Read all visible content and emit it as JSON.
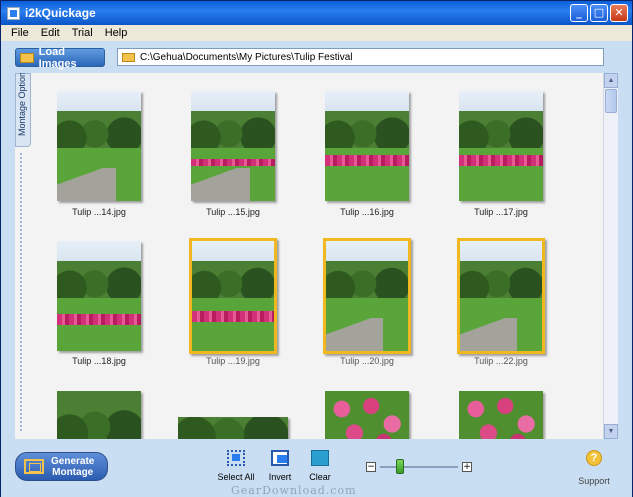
{
  "window": {
    "title": "i2kQuickage"
  },
  "menu": [
    "File",
    "Edit",
    "Trial",
    "Help"
  ],
  "toolbar": {
    "load_label": "Load Images",
    "path": "C:\\Gehua\\Documents\\My Pictures\\Tulip Festival"
  },
  "sidebar": {
    "tab_label": "Montage Options >"
  },
  "thumbnails": [
    {
      "caption": "Tulip ...14.jpg",
      "selected": false
    },
    {
      "caption": "Tulip ...15.jpg",
      "selected": false
    },
    {
      "caption": "Tulip ...16.jpg",
      "selected": false
    },
    {
      "caption": "Tulip ...17.jpg",
      "selected": false
    },
    {
      "caption": "Tulip ...18.jpg",
      "selected": false
    },
    {
      "caption": "Tulip ...19.jpg",
      "selected": true
    },
    {
      "caption": "Tulip ...20.jpg",
      "selected": true
    },
    {
      "caption": "Tulip ...22.jpg",
      "selected": true
    }
  ],
  "bottom": {
    "generate_line1": "Generate",
    "generate_line2": "Montage",
    "select_all": "Select All",
    "invert": "Invert",
    "clear": "Clear",
    "support": "Support"
  },
  "watermark": "GearDownload.com",
  "colors": {
    "selection": "#f0b81e",
    "accent": "#2a7ef0"
  }
}
